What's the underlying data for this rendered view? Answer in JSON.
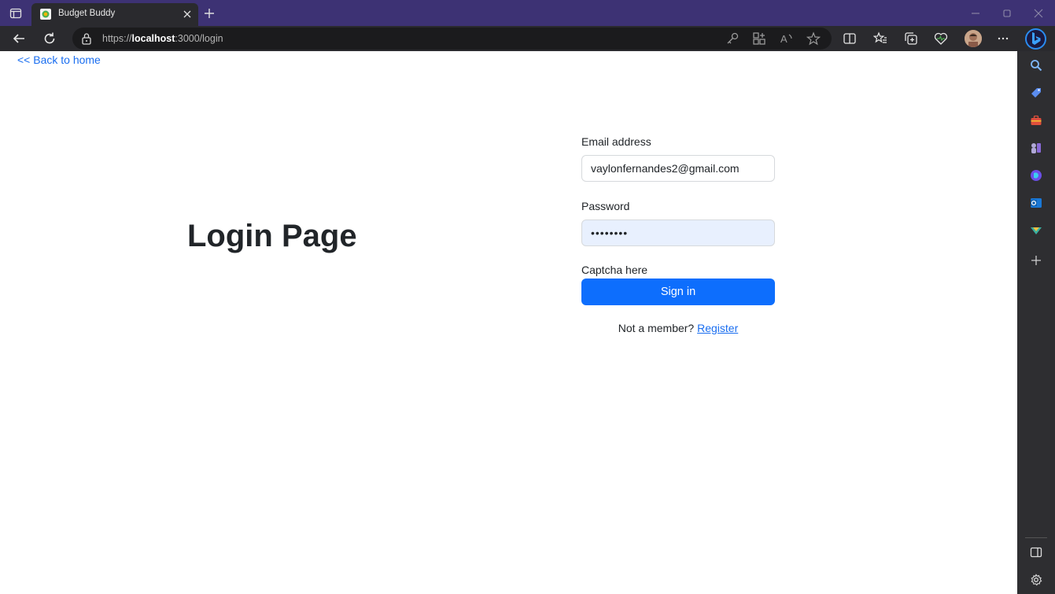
{
  "browser": {
    "tab_title": "Budget Buddy",
    "url_prefix": "https://",
    "url_host": "localhost",
    "url_rest": ":3000/login"
  },
  "page": {
    "back_link": "<< Back to home",
    "heading": "Login Page",
    "email_label": "Email address",
    "email_value": "vaylonfernandes2@gmail.com",
    "password_label": "Password",
    "password_value": "vaylon12",
    "captcha_text": "Captcha here",
    "signin_label": "Sign in",
    "not_member_text": "Not a member?",
    "register_link": "Register"
  },
  "colors": {
    "titlebar": "#3d3274",
    "toolbar": "#2a2a2e",
    "primary_button": "#0d6efd",
    "link": "#1a6ef0",
    "autofill_bg": "#e8f0fe"
  }
}
